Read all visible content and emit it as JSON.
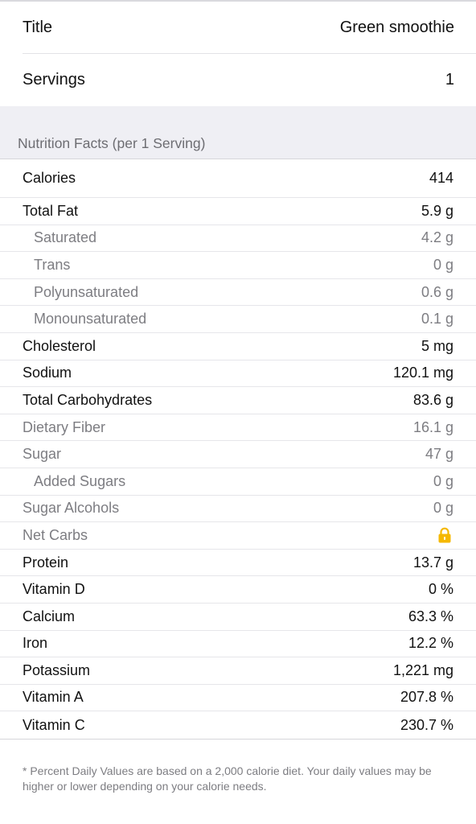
{
  "title_row": {
    "label": "Title",
    "value": "Green smoothie"
  },
  "servings_row": {
    "label": "Servings",
    "value": "1"
  },
  "section_header": "Nutrition Facts (per 1 Serving)",
  "nutrients": [
    {
      "label": "Calories",
      "value": "414"
    },
    {
      "label": "Total Fat",
      "value": "5.9 g"
    },
    {
      "label": "Saturated",
      "value": "4.2 g"
    },
    {
      "label": "Trans",
      "value": "0 g"
    },
    {
      "label": "Polyunsaturated",
      "value": "0.6 g"
    },
    {
      "label": "Monounsaturated",
      "value": "0.1 g"
    },
    {
      "label": "Cholesterol",
      "value": "5 mg"
    },
    {
      "label": "Sodium",
      "value": "120.1 mg"
    },
    {
      "label": "Total Carbohydrates",
      "value": "83.6 g"
    },
    {
      "label": "Dietary Fiber",
      "value": "16.1 g"
    },
    {
      "label": "Sugar",
      "value": "47 g"
    },
    {
      "label": "Added Sugars",
      "value": "0 g"
    },
    {
      "label": "Sugar Alcohols",
      "value": "0 g"
    },
    {
      "label": "Net Carbs",
      "value": "",
      "icon": "lock-icon",
      "icon_color": "#f5b800"
    },
    {
      "label": "Protein",
      "value": "13.7 g"
    },
    {
      "label": "Vitamin D",
      "value": "0 %"
    },
    {
      "label": "Calcium",
      "value": "63.3 %"
    },
    {
      "label": "Iron",
      "value": "12.2 %"
    },
    {
      "label": "Potassium",
      "value": "1,221 mg"
    },
    {
      "label": "Vitamin A",
      "value": "207.8 %"
    },
    {
      "label": "Vitamin C",
      "value": "230.7 %"
    }
  ],
  "footer_note": "* Percent Daily Values are based on a 2,000 calorie diet.  Your daily values may be higher or lower depending on your calorie needs.",
  "colors": {
    "primary_text": "#111111",
    "secondary_text": "#7d7d82",
    "group_background": "#efeff4",
    "lock_icon": "#f5b800"
  }
}
